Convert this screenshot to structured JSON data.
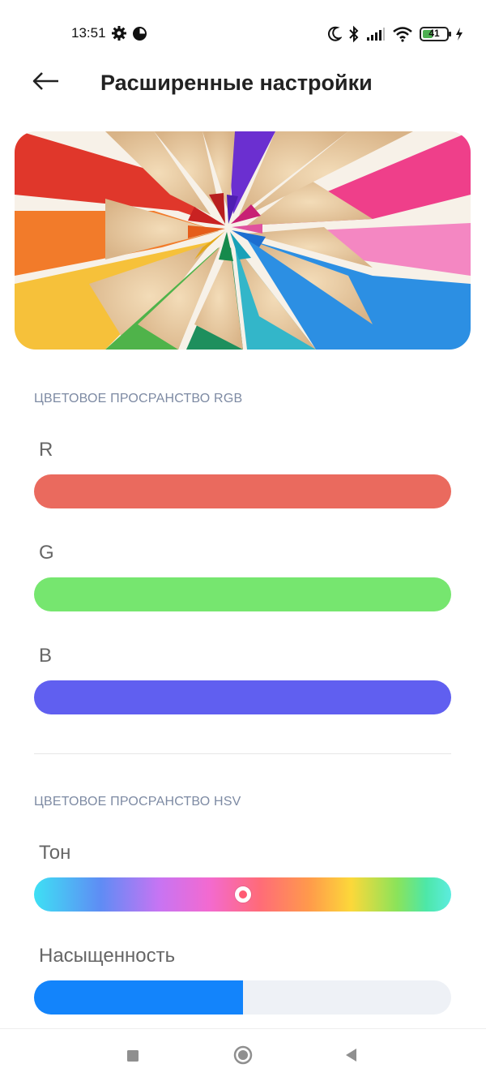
{
  "status_bar": {
    "time": "13:51",
    "battery_level": "41",
    "icons": [
      "gear-icon",
      "pie-icon",
      "moon-icon",
      "bluetooth-icon",
      "signal-icon",
      "wifi-icon",
      "battery-icon",
      "charging-icon"
    ]
  },
  "header": {
    "back_icon": "arrow-left-icon",
    "title": "Расширенные настройки"
  },
  "hero_image": {
    "subject": "colored-pencils-photo"
  },
  "rgb_section": {
    "label": "ЦВЕТОВОЕ ПРОСРАНСТВО RGB",
    "sliders": [
      {
        "label": "R",
        "color": "#ea6a5e"
      },
      {
        "label": "G",
        "color": "#76e66f"
      },
      {
        "label": "B",
        "color": "#605ff0"
      }
    ]
  },
  "hsv_section": {
    "label": "ЦВЕТОВОЕ ПРОСРАНСТВО HSV",
    "hue": {
      "label": "Тон",
      "thumb_fraction": 0.5
    },
    "saturation": {
      "label": "Насыщенность",
      "value_fraction": 0.5,
      "fill_color": "#1384fb",
      "track_color": "#eef1f6"
    }
  },
  "nav_bar": {
    "icons": [
      "recents-square-icon",
      "home-circle-icon",
      "back-triangle-icon"
    ]
  }
}
